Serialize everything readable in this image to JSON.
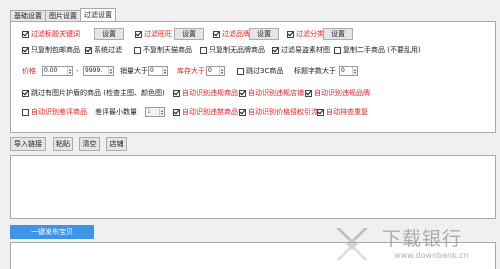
{
  "tabs": [
    "基础设置",
    "图片设置",
    "过滤设置"
  ],
  "row1": [
    {
      "label": "过滤标题关键词",
      "red": true,
      "checked": true,
      "button": "设置"
    },
    {
      "label": "过滤旺旺",
      "red": true,
      "checked": true,
      "button": "设置"
    },
    {
      "label": "过滤品牌",
      "red": true,
      "checked": true,
      "button": "设置"
    },
    {
      "label": "过滤分类",
      "red": true,
      "checked": true,
      "button": "设置"
    }
  ],
  "row2": [
    {
      "label": "只复制包邮商品",
      "checked": true
    },
    {
      "label": "系统过滤",
      "checked": true
    },
    {
      "label": "不复制天猫商品",
      "checked": false
    },
    {
      "label": "只复制无品牌商品",
      "checked": false
    },
    {
      "label": "过滤易盗素材图",
      "checked": true
    },
    {
      "label": "复制二手商品 (不要乱用)",
      "checked": false
    }
  ],
  "row3": {
    "price_label": "价格",
    "price_min": "0.00",
    "dash": "-",
    "price_max": "9999.",
    "sales_label": "销量大于",
    "sales_value": "0",
    "stock_label": "库存大于",
    "stock_value": "0",
    "skip_3c_label": "跳过3C商品",
    "skip_3c_checked": false,
    "title_len_label": "标题字数大于",
    "title_len_value": "0"
  },
  "row4": [
    {
      "label": "跳过有图片护盾的商品 (检查主图、颜色图)",
      "checked": true,
      "red": false
    },
    {
      "label": "自动识别违规商品",
      "checked": true,
      "red": true
    },
    {
      "label": "自动识别违规店铺",
      "checked": true,
      "red": true
    },
    {
      "label": "自动识别违规品牌",
      "checked": true,
      "red": true
    }
  ],
  "row5": {
    "auto_stock_label": "自动识别差评商品",
    "auto_stock_checked": false,
    "min_qty_label": "差评最小数量",
    "min_qty_value": "1",
    "items": [
      {
        "label": "自动识别违禁商品",
        "checked": true,
        "red": true
      },
      {
        "label": "自动识别价格侵权引流",
        "checked": true,
        "red": true
      },
      {
        "label": "自动排查重复",
        "checked": true,
        "red": true
      }
    ]
  },
  "actions": [
    "导入链接",
    "粘贴",
    "清空",
    "店铺"
  ],
  "publish_label": "一键发布宝贝",
  "watermark": {
    "text": "下载银行",
    "url": "www.downbank.cn"
  },
  "colors": {
    "accent": "#3e95e8",
    "red_text": "#e02020"
  }
}
